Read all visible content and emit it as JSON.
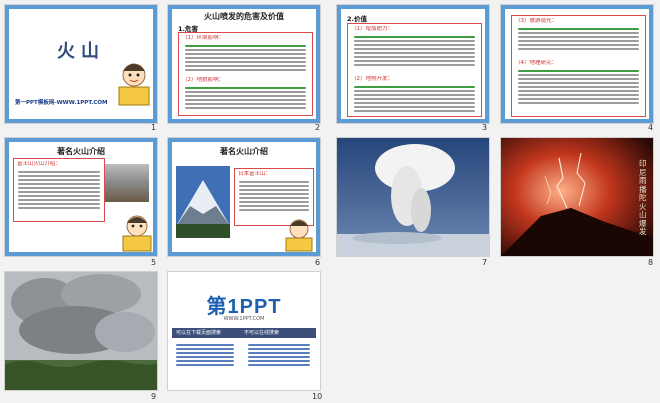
{
  "slides": [
    {
      "num": "1",
      "title": "火山",
      "footer": "第一PPT模板网-WWW.1PPT.COM"
    },
    {
      "num": "2",
      "title": "火山喷发的危害及价值",
      "subtitle": "1.危害",
      "highlights": [
        "（1）环境影响：",
        "（2）地貌影响："
      ]
    },
    {
      "num": "3",
      "subtitle": "2.价值",
      "highlights": [
        "（1）增加肥力：",
        "（2）地热开发："
      ]
    },
    {
      "num": "4",
      "highlights": [
        "（3）旅游观光：",
        "（4）地理研究："
      ]
    },
    {
      "num": "5",
      "title": "著名火山介绍",
      "highlights": [
        "富士山火山介绍："
      ]
    },
    {
      "num": "6",
      "title": "著名火山介绍",
      "highlights": [
        "日本富士山："
      ]
    },
    {
      "num": "7"
    },
    {
      "num": "8",
      "caption": "印尼雨播陀火山爆发"
    },
    {
      "num": "9"
    },
    {
      "num": "10",
      "logo_main": "第1PPT",
      "logo_sub": "WWW.1PPT.COM",
      "bar_left": "可以在下载页面搜索",
      "bar_right": "不可以在线搜索"
    }
  ],
  "colors": {
    "frame_blue": "#5d9bd5",
    "title_green": "#2e7d32",
    "highlight_red": "#d12b2b",
    "selection": "#f2a200",
    "logo_blue": "#1f5fb0"
  }
}
